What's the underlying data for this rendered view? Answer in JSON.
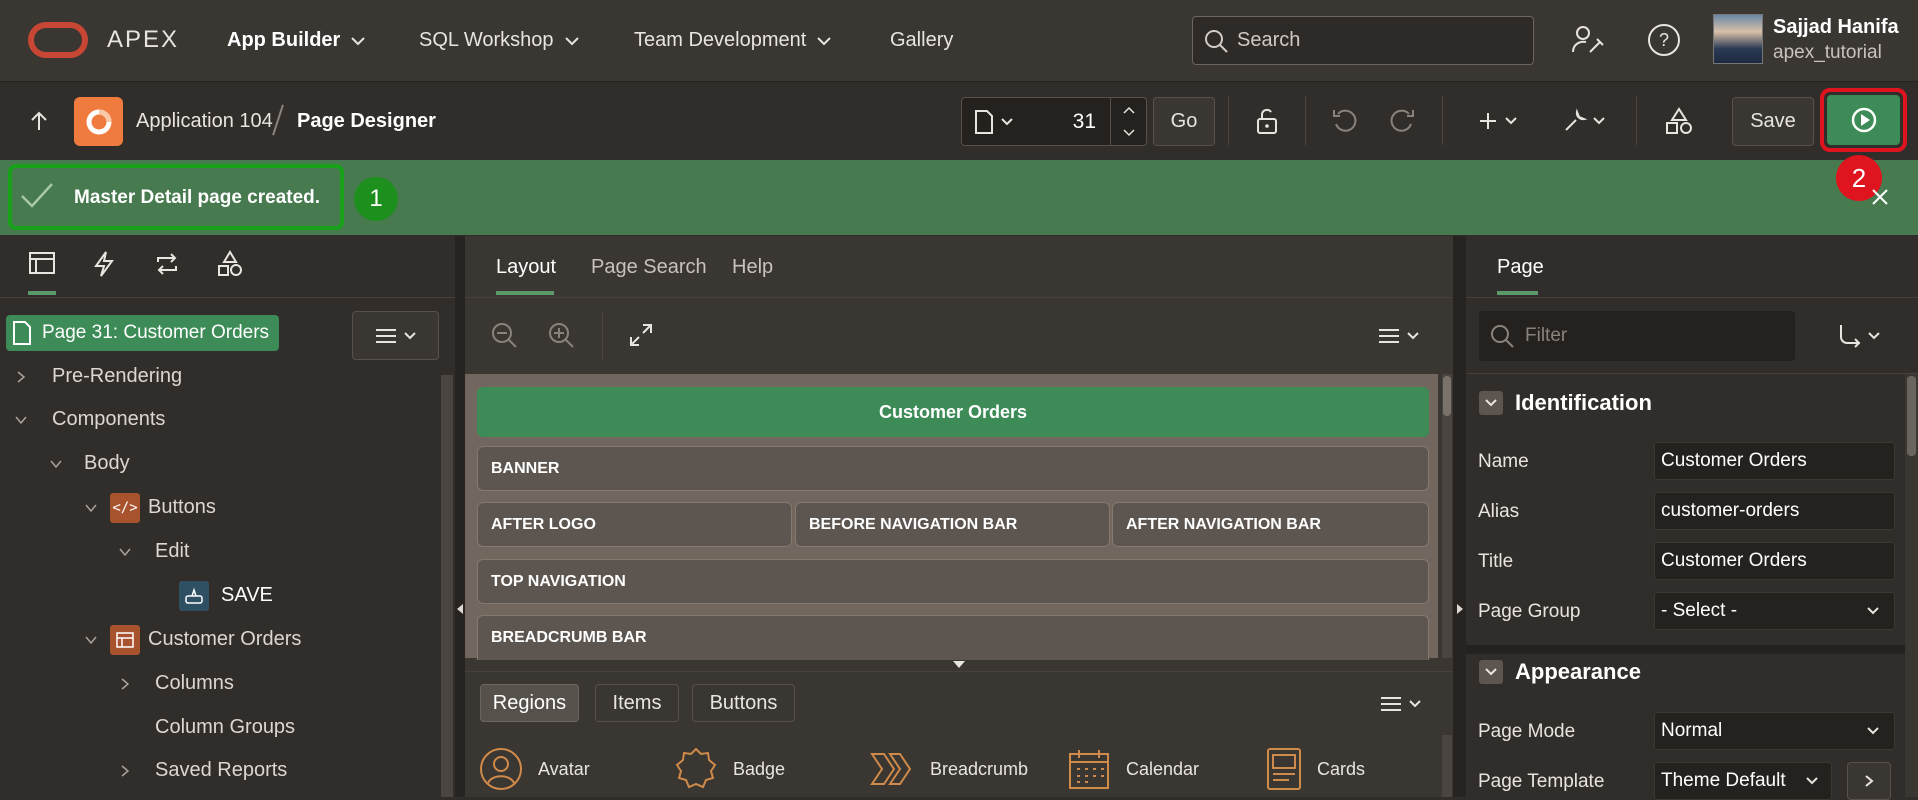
{
  "topnav": {
    "brand": "APEX",
    "menu": [
      "App Builder",
      "SQL Workshop",
      "Team Development",
      "Gallery"
    ],
    "search_placeholder": "Search",
    "user_name": "Sajjad Hanifa",
    "workspace": "apex_tutorial"
  },
  "toolbar": {
    "app_label": "Application 104",
    "page_designer_label": "Page Designer",
    "page_number": "31",
    "go_label": "Go",
    "save_label": "Save"
  },
  "alert": {
    "message": "Master Detail page created.",
    "callout_1": "1",
    "callout_2": "2"
  },
  "left_panel": {
    "page_node": "Page 31: Customer Orders",
    "tree": [
      "Pre-Rendering",
      "Components",
      "Body",
      "Buttons",
      "Edit",
      "SAVE",
      "Customer Orders",
      "Columns",
      "Column Groups",
      "Saved Reports"
    ]
  },
  "center": {
    "tabs": [
      "Layout",
      "Page Search",
      "Help"
    ],
    "page_title_region": "Customer Orders",
    "regions": {
      "banner": "BANNER",
      "after_logo": "AFTER LOGO",
      "before_nav": "BEFORE NAVIGATION BAR",
      "after_nav": "AFTER NAVIGATION BAR",
      "top_nav": "TOP NAVIGATION",
      "breadcrumb_bar": "BREADCRUMB BAR"
    },
    "gallery_tabs": [
      "Regions",
      "Items",
      "Buttons"
    ],
    "gallery_items": [
      "Avatar",
      "Badge",
      "Breadcrumb",
      "Calendar",
      "Cards"
    ]
  },
  "right_panel": {
    "tab": "Page",
    "filter_placeholder": "Filter",
    "identification": {
      "heading": "Identification",
      "name_label": "Name",
      "name_value": "Customer Orders",
      "alias_label": "Alias",
      "alias_value": "customer-orders",
      "title_label": "Title",
      "title_value": "Customer Orders",
      "group_label": "Page Group",
      "group_value": "- Select -"
    },
    "appearance": {
      "heading": "Appearance",
      "mode_label": "Page Mode",
      "mode_value": "Normal",
      "template_label": "Page Template",
      "template_value": "Theme Default"
    }
  },
  "colors": {
    "success_bar": "#477a4f",
    "callout_green": "#2e8b2e",
    "callout_red": "#e0141e",
    "run_button": "#3d8b57",
    "oracle_red": "#c74634",
    "gallery_icon": "#d08a4a"
  }
}
